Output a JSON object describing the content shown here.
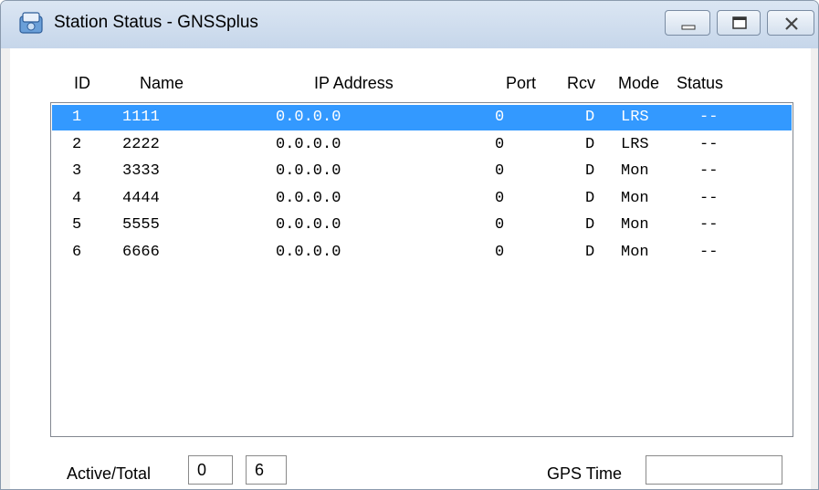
{
  "window": {
    "title": "Station Status - GNSSplus"
  },
  "columns": {
    "id": "ID",
    "name": "Name",
    "ip": "IP Address",
    "port": "Port",
    "rcv": "Rcv",
    "mode": "Mode",
    "status": "Status"
  },
  "rows": [
    {
      "id": "1",
      "name": "1111",
      "ip": "0.0.0.0",
      "port": "0",
      "rcv": "D",
      "mode": "LRS",
      "status": "--",
      "selected": true
    },
    {
      "id": "2",
      "name": "2222",
      "ip": "0.0.0.0",
      "port": "0",
      "rcv": "D",
      "mode": "LRS",
      "status": "--"
    },
    {
      "id": "3",
      "name": "3333",
      "ip": "0.0.0.0",
      "port": "0",
      "rcv": "D",
      "mode": "Mon",
      "status": "--"
    },
    {
      "id": "4",
      "name": "4444",
      "ip": "0.0.0.0",
      "port": "0",
      "rcv": "D",
      "mode": "Mon",
      "status": "--"
    },
    {
      "id": "5",
      "name": "5555",
      "ip": "0.0.0.0",
      "port": "0",
      "rcv": "D",
      "mode": "Mon",
      "status": "--"
    },
    {
      "id": "6",
      "name": "6666",
      "ip": "0.0.0.0",
      "port": "0",
      "rcv": "D",
      "mode": "Mon",
      "status": "--"
    }
  ],
  "footer": {
    "active_total_label": "Active/Total",
    "active": "0",
    "total": "6",
    "gps_time_label": "GPS Time",
    "gps_time": ""
  },
  "colors": {
    "selection": "#3399ff"
  }
}
